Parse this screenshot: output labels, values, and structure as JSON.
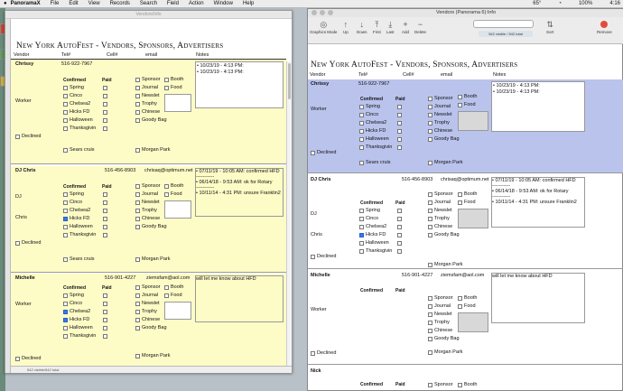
{
  "menubar": {
    "app": "PanoramaX",
    "items": [
      "File",
      "Edit",
      "View",
      "Records",
      "Search",
      "Field",
      "Action",
      "Window",
      "Help"
    ],
    "status": [
      "65°",
      "100%",
      "4:16"
    ]
  },
  "left_window": {
    "title": "Vendors/Info",
    "status": "542 visible/542 total"
  },
  "right_window": {
    "title": "Vendors (Panorama 6):Info"
  },
  "toolbar": {
    "buttons": [
      {
        "label": "Graphics Mode",
        "glyph": "◎"
      },
      {
        "label": "Up",
        "glyph": "↑"
      },
      {
        "label": "Down",
        "glyph": "↓"
      },
      {
        "label": "First",
        "glyph": "⤒"
      },
      {
        "label": "Last",
        "glyph": "⤓"
      },
      {
        "label": "Add",
        "glyph": "+"
      },
      {
        "label": "Delete",
        "glyph": "−"
      }
    ],
    "counter": "542 visible / 542 total",
    "sort": "Sort",
    "remove": "Remove"
  },
  "form": {
    "header": "New York AutoFest - Vendors, Sponsors, Advertisers",
    "columns": {
      "vendor": "Vendor",
      "tel": "Tel#",
      "cell": "Cell#",
      "email": "email",
      "notes": "Notes"
    },
    "confirmed": "Confirmed",
    "paid": "Paid",
    "events": [
      "Spring",
      "Cinco",
      "Chelsea2",
      "Hicks FD",
      "Halloween",
      "Thanksgivin"
    ],
    "options": [
      "Sponsor",
      "Journal",
      "Newslet",
      "Trophy",
      "Chinese",
      "Goody Bag"
    ],
    "booth": "Booth",
    "food": "Food",
    "declined": "Declined",
    "sears": "Sears cruis",
    "morgan": "Morgan Park"
  },
  "records": [
    {
      "name": "Chrissy",
      "tel": "516-922-7967",
      "cell": "",
      "email": "",
      "line2": "Worker",
      "line3": "",
      "confirmed": [
        false,
        false,
        false,
        false,
        false,
        false
      ],
      "notes": [
        "• 10/23/19 -  4:13 PM:",
        "• 10/23/19 -  4:13 PM:"
      ]
    },
    {
      "name": "DJ Chris",
      "tel": "516-456-8903",
      "cell": "",
      "email": "chrisaq@optimum.net",
      "line2": "DJ",
      "line3": "Chris",
      "confirmed": [
        false,
        false,
        false,
        true,
        false,
        false
      ],
      "notes": [
        "• 07/11/19 - 10:05 AM:   confirmed HFD",
        "-----------",
        "• 06/14/18 - 9:53 AM:    ok for Rotary",
        "-----------",
        "• 10/11/14 - 4:31 PM:    unsure Franklin2"
      ]
    },
    {
      "name": "Michelle",
      "tel": "516-901-4227",
      "cell": "",
      "email": "ziemsfam@aol.com",
      "line2": "Worker",
      "line3": "",
      "confirmed": [
        false,
        false,
        true,
        true,
        false,
        false
      ],
      "notes": [
        "will let me know about HFD"
      ]
    },
    {
      "name": "Nick",
      "tel": "",
      "cell": "",
      "email": "",
      "line2": "",
      "line3": "",
      "confirmed": [
        false,
        false,
        false,
        false,
        false,
        false
      ],
      "notes": []
    }
  ],
  "colors": {
    "highlight": "#b9c3ec",
    "record_bg": "#fdfbc6",
    "accent": "#3478f6"
  }
}
